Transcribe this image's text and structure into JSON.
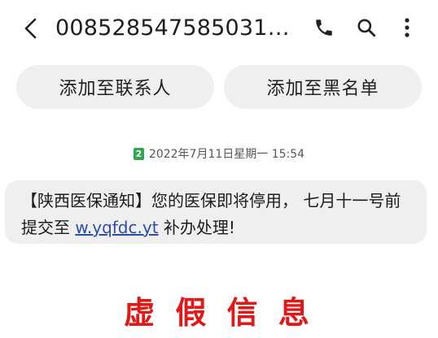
{
  "header": {
    "title": "008528547585031…",
    "back_icon": "back-arrow-icon",
    "call_icon": "phone-icon",
    "search_icon": "search-icon",
    "more_icon": "more-vertical-icon"
  },
  "actions": {
    "add_contact_label": "添加至联系人",
    "add_blacklist_label": "添加至黑名单"
  },
  "message": {
    "sim_slot": "2",
    "timestamp": "2022年7月11日星期一 15:54",
    "text_before": "【陕西医保通知】您的医保即将停用， 七月十一号前提交至 ",
    "link": "w.yqfdc.yt",
    "text_after": " 补办处理!"
  },
  "stamp": {
    "text": "虚 假 信 息",
    "color": "#e01818"
  },
  "colors": {
    "pill_bg": "#efefef",
    "bubble_bg": "#efefef",
    "link": "#2a4ea8",
    "sim_badge": "#2aa84a"
  }
}
